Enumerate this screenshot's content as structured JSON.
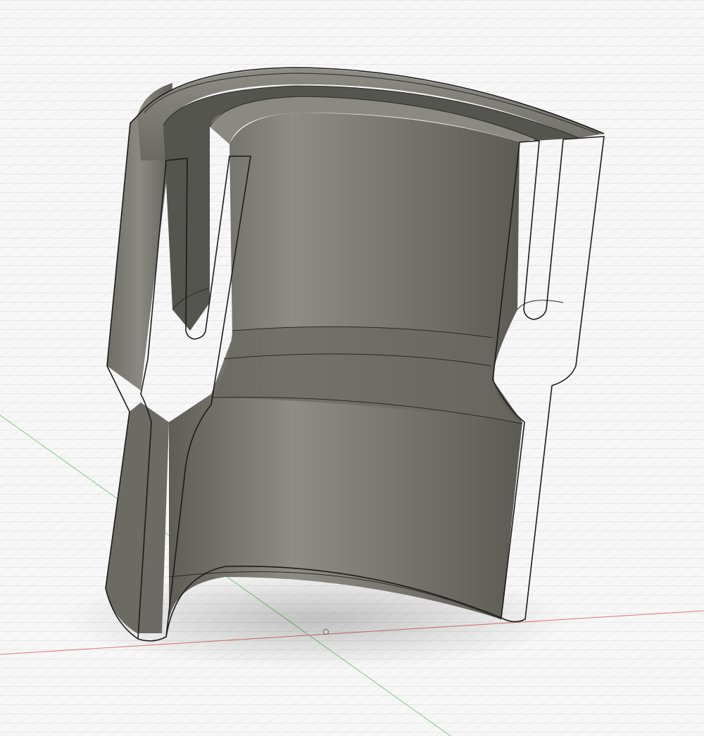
{
  "viewport": {
    "background_color": "#f7f7f7",
    "grid_color": "#d4d4d4",
    "x_axis_color": "#e07a7a",
    "y_axis_color": "#8ccc8c"
  },
  "model": {
    "body_color": "#7a7a72",
    "section_fill_color": "#f2c7f2",
    "hatch_color": "#3a2a3a",
    "edge_color": "#1b1b1b"
  }
}
